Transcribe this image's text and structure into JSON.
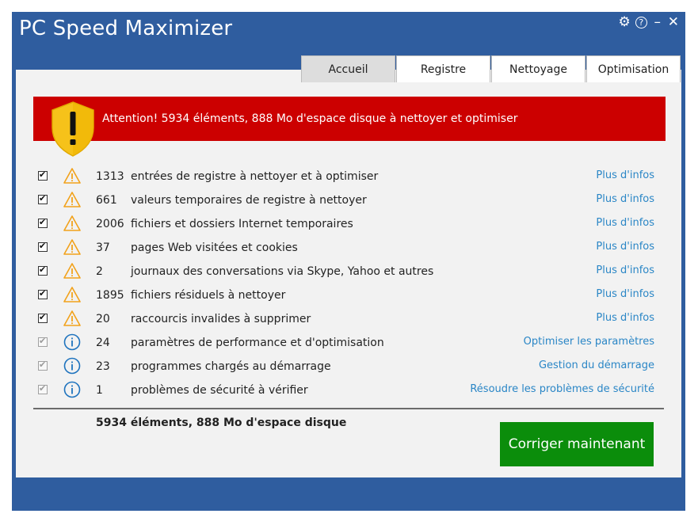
{
  "app": {
    "title": "PC Speed Maximizer"
  },
  "window_controls": {
    "settings": "⚙",
    "help": "?",
    "minimize": "–",
    "close": "✕"
  },
  "tabs": [
    {
      "label": "Accueil",
      "active": true
    },
    {
      "label": "Registre",
      "active": false
    },
    {
      "label": "Nettoyage",
      "active": false
    },
    {
      "label": "Optimisation",
      "active": false
    }
  ],
  "alert": {
    "text": "Attention! 5934 éléments, 888 Mo d'espace disque à nettoyer et optimiser"
  },
  "items": [
    {
      "checked": true,
      "icon": "warning-icon",
      "count": "1313",
      "description": "entrées de registre à nettoyer et à optimiser",
      "link": "Plus d'infos"
    },
    {
      "checked": true,
      "icon": "warning-icon",
      "count": "661",
      "description": "valeurs temporaires de registre à nettoyer",
      "link": "Plus d'infos"
    },
    {
      "checked": true,
      "icon": "warning-icon",
      "count": "2006",
      "description": "fichiers et dossiers Internet temporaires",
      "link": "Plus d'infos"
    },
    {
      "checked": true,
      "icon": "warning-icon",
      "count": "37",
      "description": "pages Web visitées et cookies",
      "link": "Plus d'infos"
    },
    {
      "checked": true,
      "icon": "warning-icon",
      "count": "2",
      "description": "journaux des conversations via Skype, Yahoo et autres",
      "link": "Plus d'infos"
    },
    {
      "checked": true,
      "icon": "warning-icon",
      "count": "1895",
      "description": "fichiers résiduels à nettoyer",
      "link": "Plus d'infos"
    },
    {
      "checked": true,
      "icon": "warning-icon",
      "count": "20",
      "description": "raccourcis invalides à supprimer",
      "link": "Plus d'infos"
    },
    {
      "checked": true,
      "icon": "info-icon",
      "count": "24",
      "description": "paramètres de performance et d'optimisation",
      "link": "Optimiser les paramètres"
    },
    {
      "checked": true,
      "icon": "info-icon",
      "count": "23",
      "description": "programmes chargés au démarrage",
      "link": "Gestion du démarrage"
    },
    {
      "checked": true,
      "icon": "info-icon",
      "count": "1",
      "description": "problèmes de sécurité à vérifier",
      "link": "Résoudre les problèmes de sécurité"
    }
  ],
  "summary": {
    "text": "5934 éléments, 888 Mo d'espace disque"
  },
  "fix_button": {
    "label": "Corriger maintenant"
  },
  "colors": {
    "titlebar": "#2f5d9f",
    "alert": "#cc0000",
    "link": "#2a86c6",
    "button": "#0b8d0b",
    "warning": "#f2a21b",
    "info": "#1e73be"
  }
}
